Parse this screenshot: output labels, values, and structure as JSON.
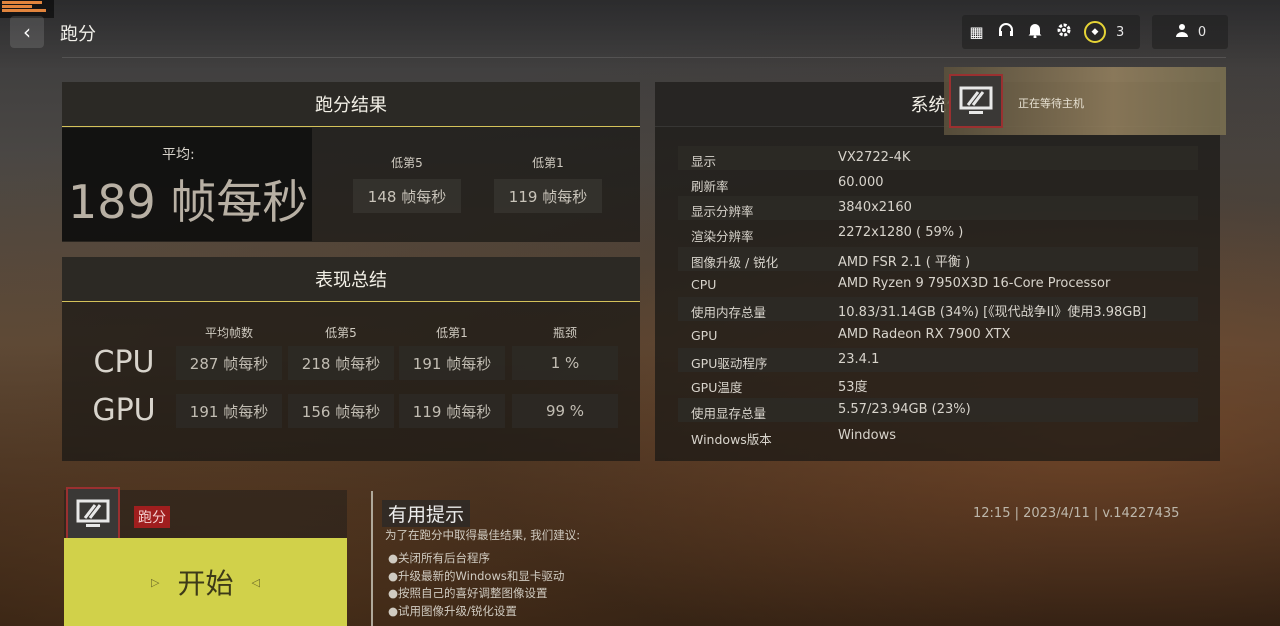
{
  "header": {
    "back_label": "‹",
    "title": "跑分",
    "level": "3",
    "friends_count": "0",
    "icons": [
      "grid-icon",
      "headset-icon",
      "bell-icon",
      "gear-icon"
    ]
  },
  "score_panel": {
    "title": "跑分结果",
    "avg_label": "平均:",
    "avg_value": "189 帧每秒",
    "low5_label": "低第5",
    "low5_value": "148 帧每秒",
    "low1_label": "低第1",
    "low1_value": "119 帧每秒"
  },
  "summary_panel": {
    "title": "表现总结",
    "columns": [
      "平均帧数",
      "低第5",
      "低第1",
      "瓶颈"
    ],
    "rows": [
      {
        "label": "CPU",
        "cells": [
          "287 帧每秒",
          "218 帧每秒",
          "191 帧每秒",
          "1 %"
        ]
      },
      {
        "label": "GPU",
        "cells": [
          "191 帧每秒",
          "156 帧每秒",
          "119 帧每秒",
          "99 %"
        ]
      }
    ]
  },
  "system_panel": {
    "title": "系统信",
    "host_status": "正在等待主机",
    "rows": [
      {
        "key": "显示",
        "value": "VX2722-4K"
      },
      {
        "key": "刷新率",
        "value": "60.000"
      },
      {
        "key": "显示分辨率",
        "value": "3840x2160"
      },
      {
        "key": "渲染分辨率",
        "value": "2272x1280 ( 59% )"
      },
      {
        "key": "图像升级 / 锐化",
        "value": "AMD FSR 2.1 ( 平衡 )"
      },
      {
        "key": "CPU",
        "value": "AMD Ryzen 9 7950X3D 16-Core Processor"
      },
      {
        "key": "使用内存总量",
        "value": "10.83/31.14GB (34%) [《现代战争II》使用3.98GB]"
      },
      {
        "key": "GPU",
        "value": "AMD Radeon RX 7900 XTX"
      },
      {
        "key": "GPU驱动程序",
        "value": "23.4.1"
      },
      {
        "key": "GPU温度",
        "value": "53度"
      },
      {
        "key": "使用显存总量",
        "value": "5.57/23.94GB (23%)"
      },
      {
        "key": "Windows版本",
        "value": "Windows"
      }
    ]
  },
  "start": {
    "tag": "跑分",
    "button_label": "开始"
  },
  "tips": {
    "title": "有用提示",
    "subtitle": "为了在跑分中取得最佳结果, 我们建议:",
    "items": [
      "●关闭所有后台程序",
      "●升级最新的Windows和显卡驱动",
      "●按照自己的喜好调整图像设置",
      "●试用图像升级/锐化设置"
    ]
  },
  "footer": {
    "info": "12:15 | 2023/4/11 | v.14227435"
  },
  "colors": {
    "accent": "#d1d14a",
    "alert_red": "#a01e1e",
    "ring_yellow": "#e6d436"
  }
}
